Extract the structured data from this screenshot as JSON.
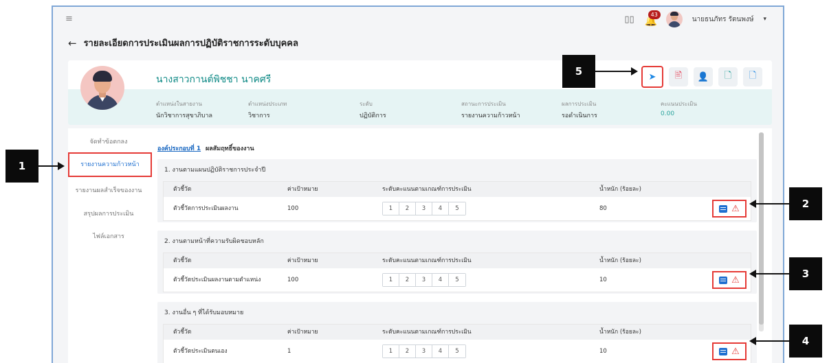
{
  "header": {
    "notification_count": "43",
    "user_name": "นายธนภัทร รัตนพงษ์",
    "user_caret": "▾"
  },
  "page": {
    "back_icon": "←",
    "title": "รายละเอียดการประเมินผลการปฏิบัติราชการระดับบุคคล"
  },
  "profile": {
    "name": "นางสาวกานต์พิชชา นาคศรี",
    "fields": [
      {
        "label": "ตำแหน่งในสายงาน",
        "value": "นักวิชาการสุขาภิบาล"
      },
      {
        "label": "ตำแหน่งประเภท",
        "value": "วิชาการ"
      },
      {
        "label": "ระดับ",
        "value": "ปฏิบัติการ"
      },
      {
        "label": "สถานะการประเมิน",
        "value": "รายงานความก้าวหน้า"
      },
      {
        "label": "ผลการประเมิน",
        "value": "รอดำเนินการ"
      },
      {
        "label": "คะแนนประเมิน",
        "value": "0.00"
      }
    ]
  },
  "actions": {
    "send_icon": "➤",
    "pdf_icon": "🖹",
    "person_icon": "👤",
    "doc_add_icon": "🗋",
    "doc_export_icon": "🗋"
  },
  "side_menu": {
    "items": [
      "จัดทำข้อตกลง",
      "รายงานความก้าวหน้า",
      "รายงานผลสำเร็จของงาน",
      "สรุปผลการประเมิน",
      "ไฟล์เอกสาร"
    ]
  },
  "section": {
    "link": "องค์ประกอบที่ 1",
    "title": "ผลสัมฤทธิ์ของงาน"
  },
  "table_headers": {
    "indicator": "ตัวชี้วัด",
    "target": "ค่าเป้าหมาย",
    "scale": "ระดับคะแนนตามเกณฑ์การประเมิน",
    "weight": "น้ำหนัก (ร้อยละ)"
  },
  "scale_levels": [
    "1",
    "2",
    "3",
    "4",
    "5"
  ],
  "groups": [
    {
      "title": "1. งานตามแผนปฏิบัติราชการประจำปี",
      "indicator": "ตัวชี้วัดการประเมินผลงาน",
      "target": "100",
      "weight": "80"
    },
    {
      "title": "2. งานตามหน้าที่ความรับผิดชอบหลัก",
      "indicator": "ตัวชี้วัดประเมินผลงานตามตำแหน่ง",
      "target": "100",
      "weight": "10"
    },
    {
      "title": "3. งานอื่น ๆ ที่ได้รับมอบหมาย",
      "indicator": "ตัวชี้วัดประเมินตนเอง",
      "target": "1",
      "weight": "10"
    }
  ],
  "callouts": [
    "1",
    "2",
    "3",
    "4",
    "5"
  ],
  "icons": {
    "menu": "menu-collapse-icon",
    "book": "book-icon",
    "bell": "bell-icon",
    "warning": "⚠"
  }
}
